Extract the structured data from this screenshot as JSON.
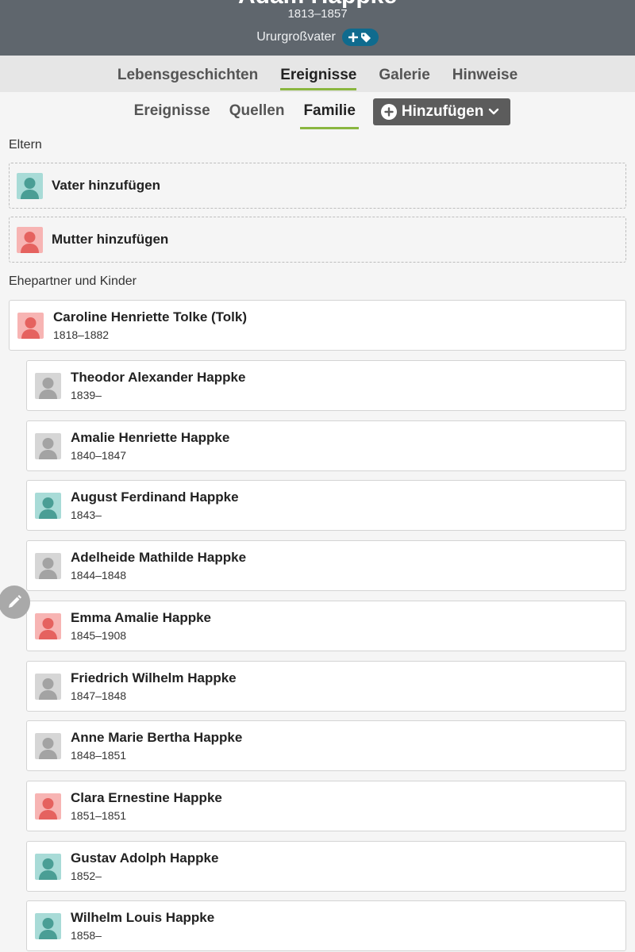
{
  "header": {
    "name": "Adam Happke",
    "years": "1813–1857",
    "relation": "Ururgroßvater",
    "tag_icons": [
      "plus-icon",
      "tag-icon"
    ],
    "background_color": "#5f666d",
    "tag_color": "#0f6b8e"
  },
  "main_tabs": [
    {
      "label": "Lebensgeschichten",
      "active": false
    },
    {
      "label": "Ereignisse",
      "active": true
    },
    {
      "label": "Galerie",
      "active": false
    },
    {
      "label": "Hinweise",
      "active": false
    }
  ],
  "sub_tabs": [
    {
      "label": "Ereignisse",
      "active": false
    },
    {
      "label": "Quellen",
      "active": false
    },
    {
      "label": "Familie",
      "active": true
    }
  ],
  "add_button": {
    "label": "Hinzufügen",
    "icon": "plus-circle-icon",
    "dropdown_icon": "chevron-down-icon"
  },
  "accent_color": "#8ab63f",
  "parents": {
    "section_label": "Eltern",
    "add_father": {
      "label": "Vater hinzufügen",
      "gender": "male"
    },
    "add_mother": {
      "label": "Mutter hinzufügen",
      "gender": "female"
    }
  },
  "spouses": {
    "section_label": "Ehepartner und Kinder",
    "spouse": {
      "name": "Caroline Henriette Tolke (Tolk)",
      "years": "1818–1882",
      "gender": "female"
    },
    "children": [
      {
        "name": "Theodor Alexander Happke",
        "years": "1839–",
        "gender": "unknown"
      },
      {
        "name": "Amalie Henriette Happke",
        "years": "1840–1847",
        "gender": "unknown"
      },
      {
        "name": "August Ferdinand Happke",
        "years": "1843–",
        "gender": "male"
      },
      {
        "name": "Adelheide Mathilde Happke",
        "years": "1844–1848",
        "gender": "unknown"
      },
      {
        "name": "Emma Amalie Happke",
        "years": "1845–1908",
        "gender": "female"
      },
      {
        "name": "Friedrich Wilhelm Happke",
        "years": "1847–1848",
        "gender": "unknown"
      },
      {
        "name": "Anne Marie Bertha Happke",
        "years": "1848–1851",
        "gender": "unknown"
      },
      {
        "name": "Clara Ernestine Happke",
        "years": "1851–1851",
        "gender": "female"
      },
      {
        "name": "Gustav Adolph Happke",
        "years": "1852–",
        "gender": "male"
      },
      {
        "name": "Wilhelm Louis Happke",
        "years": "1858–",
        "gender": "male"
      }
    ]
  },
  "edit_button": {
    "icon": "pencil-icon"
  }
}
